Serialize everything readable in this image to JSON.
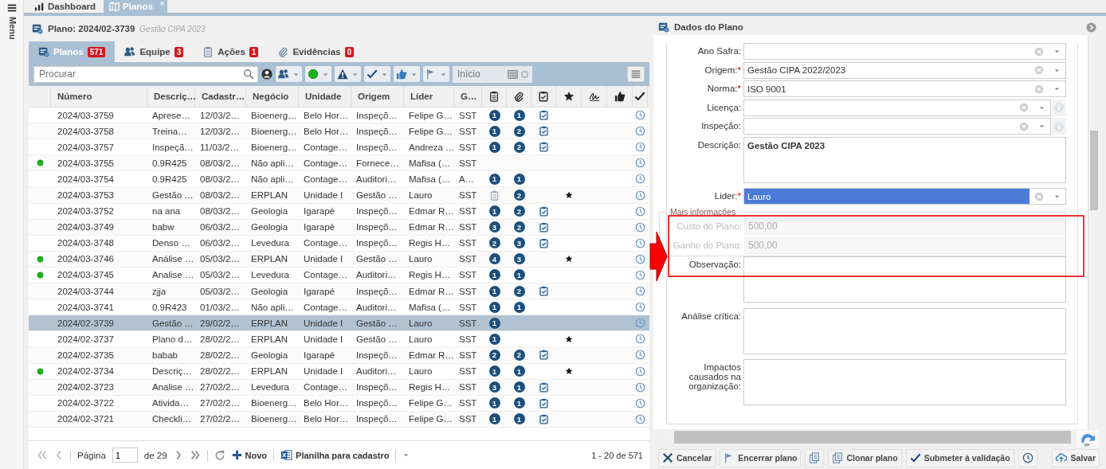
{
  "sidebar": {
    "label": "Menu"
  },
  "top_tabs": [
    {
      "label": "Dashboard",
      "kind": "chart",
      "selected": false
    },
    {
      "label": "Planos",
      "kind": "map",
      "selected": true,
      "close": "×"
    }
  ],
  "plan_header": {
    "title": "Plano: 2024/02-3739",
    "subtitle": "Gestão CIPA 2023"
  },
  "sub_tabs": [
    {
      "label": "Planos",
      "kind": "plans",
      "count": "571",
      "selected": true
    },
    {
      "label": "Equipe",
      "kind": "team",
      "count": "3",
      "selected": false
    },
    {
      "label": "Ações",
      "kind": "actions",
      "count": "1",
      "selected": false
    },
    {
      "label": "Evidências",
      "kind": "evidence",
      "count": "0",
      "selected": false
    }
  ],
  "toolbar": {
    "search_placeholder": "Procurar",
    "date_placeholder": "Início"
  },
  "table": {
    "columns": [
      "Número",
      "Descriç…",
      "Cadastr…",
      "Negócio",
      "Unidade",
      "Origem",
      "Líder",
      "G…"
    ],
    "rows": [
      {
        "number": "2024/03-3759",
        "description": "Aprese…",
        "created": "12/03/2…",
        "business": "Bioenerg…",
        "unit": "Belo Hor…",
        "origin": "Inspeçõ…",
        "leader": "Felipe G…",
        "group": "SST",
        "marked": false,
        "actions": "1",
        "evidences": "1",
        "checklist": true,
        "award": false,
        "selected": false
      },
      {
        "number": "2024/03-3758",
        "description": "Treina…",
        "created": "12/03/2…",
        "business": "Bioenerg…",
        "unit": "Belo Hor…",
        "origin": "Inspeçõ…",
        "leader": "Felipe G…",
        "group": "SST",
        "marked": false,
        "actions": "1",
        "evidences": "2",
        "checklist": true,
        "award": false,
        "selected": false
      },
      {
        "number": "2024/03-3757",
        "description": "Inspeçã…",
        "created": "11/03/2…",
        "business": "Bioenerg…",
        "unit": "Contage…",
        "origin": "Inspeçõ…",
        "leader": "Andreza …",
        "group": "SST",
        "marked": false,
        "actions": "1",
        "evidences": "2",
        "checklist": true,
        "award": false,
        "selected": false
      },
      {
        "number": "2024/03-3755",
        "description": "0.9R425",
        "created": "08/03/2…",
        "business": "Não apli…",
        "unit": "Contage…",
        "origin": "Fornece…",
        "leader": "Mafisa (…",
        "group": "SST",
        "marked": true,
        "checklist": false,
        "award": false,
        "selected": false
      },
      {
        "number": "2024/03-3754",
        "description": "0.9R425",
        "created": "08/03/2…",
        "business": "Não apli…",
        "unit": "Contage…",
        "origin": "Auditori…",
        "leader": "Mafisa (…",
        "group": "A…",
        "marked": false,
        "actions": "1",
        "evidences": "1",
        "checklist": false,
        "award": false,
        "selected": false
      },
      {
        "number": "2024/03-3753",
        "description": "Gestão …",
        "created": "08/03/2…",
        "business": "ERPLAN",
        "unit": "Unidade I",
        "origin": "Gestão …",
        "leader": "Lauro",
        "group": "SST",
        "marked": false,
        "actions_icon": true,
        "evidences": "2",
        "checklist": false,
        "award": true,
        "selected": false
      },
      {
        "number": "2024/03-3752",
        "description": "na ana",
        "created": "08/03/2…",
        "business": "Geologia",
        "unit": "Igarapé",
        "origin": "Inspeçõ…",
        "leader": "Edmar R…",
        "group": "SST",
        "marked": false,
        "actions": "1",
        "evidences": "2",
        "checklist": true,
        "award": false,
        "selected": false
      },
      {
        "number": "2024/03-3749",
        "description": "babw",
        "created": "06/03/2…",
        "business": "Geologia",
        "unit": "Igarapé",
        "origin": "Inspeçõ…",
        "leader": "Edmar R…",
        "group": "SST",
        "marked": false,
        "actions": "3",
        "evidences": "2",
        "checklist": true,
        "award": false,
        "selected": false
      },
      {
        "number": "2024/03-3748",
        "description": "Denso …",
        "created": "06/03/2…",
        "business": "Levedura",
        "unit": "Contage…",
        "origin": "Inspeçõ…",
        "leader": "Regis H…",
        "group": "SST",
        "marked": false,
        "actions": "2",
        "evidences": "3",
        "checklist": true,
        "award": false,
        "selected": false
      },
      {
        "number": "2024/03-3746",
        "description": "Análise …",
        "created": "05/03/2…",
        "business": "ERPLAN",
        "unit": "Unidade I",
        "origin": "Gestão …",
        "leader": "Lauro",
        "group": "SST",
        "marked": true,
        "actions": "4",
        "evidences": "3",
        "checklist": false,
        "award": true,
        "selected": false
      },
      {
        "number": "2024/03-3745",
        "description": "Analise …",
        "created": "05/03/2…",
        "business": "Levedura",
        "unit": "Contage…",
        "origin": "Auditori…",
        "leader": "Regis H…",
        "group": "SST",
        "marked": true,
        "actions": "1",
        "evidences": "1",
        "checklist": false,
        "award": false,
        "selected": false
      },
      {
        "number": "2024/03-3744",
        "description": "zjja",
        "created": "05/03/2…",
        "business": "Geologia",
        "unit": "Igarapé",
        "origin": "Inspeçõ…",
        "leader": "Edmar R…",
        "group": "SST",
        "marked": false,
        "actions": "1",
        "evidences": "2",
        "checklist": true,
        "award": false,
        "selected": false
      },
      {
        "number": "2024/03-3741",
        "description": "0.9R423",
        "created": "01/03/2…",
        "business": "Não apli…",
        "unit": "Contage…",
        "origin": "Auditori…",
        "leader": "Mafisa (…",
        "group": "SST",
        "marked": false,
        "actions": "1",
        "evidences": "1",
        "checklist": false,
        "award": false,
        "selected": false
      },
      {
        "number": "2024/02-3739",
        "description": "Gestão …",
        "created": "29/02/2…",
        "business": "ERPLAN",
        "unit": "Unidade I",
        "origin": "Gestão …",
        "leader": "Lauro",
        "group": "SST",
        "marked": false,
        "actions": "1",
        "checklist": false,
        "award": false,
        "selected": true
      },
      {
        "number": "2024/02-3737",
        "description": "Plano d…",
        "created": "28/02/2…",
        "business": "ERPLAN",
        "unit": "Unidade I",
        "origin": "Gestão …",
        "leader": "Lauro",
        "group": "SST",
        "marked": false,
        "actions": "1",
        "checklist": false,
        "award": true,
        "selected": false
      },
      {
        "number": "2024/02-3735",
        "description": "babab",
        "created": "28/02/2…",
        "business": "Geologia",
        "unit": "Igarapé",
        "origin": "Inspeçõ…",
        "leader": "Edmar R…",
        "group": "SST",
        "marked": false,
        "actions": "2",
        "evidences": "2",
        "checklist": true,
        "award": false,
        "selected": false
      },
      {
        "number": "2024/02-3734",
        "description": "Descriç…",
        "created": "28/02/2…",
        "business": "ERPLAN",
        "unit": "Unidade I",
        "origin": "Auditori…",
        "leader": "Lauro",
        "group": "SST",
        "marked": true,
        "actions": "1",
        "evidences": "1",
        "checklist": false,
        "award": true,
        "selected": false
      },
      {
        "number": "2024/02-3723",
        "description": "Analise …",
        "created": "27/02/2…",
        "business": "Levedura",
        "unit": "Contage…",
        "origin": "Inspeçõ…",
        "leader": "Regis H…",
        "group": "SST",
        "marked": false,
        "actions": "3",
        "evidences": "1",
        "checklist": true,
        "award": false,
        "selected": false
      },
      {
        "number": "2024/02-3722",
        "description": "Ativida…",
        "created": "27/02/2…",
        "business": "Bioenerg…",
        "unit": "Belo Hor…",
        "origin": "Inspeçõ…",
        "leader": "Felipe G…",
        "group": "SST",
        "marked": false,
        "actions": "1",
        "evidences": "1",
        "checklist": true,
        "award": false,
        "selected": false
      },
      {
        "number": "2024/02-3721",
        "description": "Checkli…",
        "created": "27/02/2…",
        "business": "Bioenerg…",
        "unit": "Belo Hor…",
        "origin": "Inspeçõ…",
        "leader": "Felipe G…",
        "group": "SST",
        "marked": false,
        "actions": "1",
        "evidences": "1",
        "checklist": true,
        "award": false,
        "selected": false
      }
    ]
  },
  "pager": {
    "page_label": "Página",
    "page": "1",
    "page_count": "de 29",
    "new_label": "Novo",
    "spreadsheet_label": "Planilha para cadastro",
    "range": "1 - 20 de 571"
  },
  "form": {
    "title": "Dados do Plano",
    "fields": [
      {
        "label": "Ano Safra:",
        "kind": "select",
        "highlighted": false
      },
      {
        "label": "Origem:",
        "required_mark": "*",
        "kind": "select",
        "value": "Gestão CIPA 2022/2023",
        "highlighted": false
      },
      {
        "label": "Norma:",
        "required_mark": "*",
        "kind": "select",
        "value": "ISO 9001",
        "highlighted": false
      },
      {
        "label": "Licença:",
        "kind": "select_info",
        "highlighted": false
      },
      {
        "label": "Inspeção:",
        "kind": "select_info",
        "highlighted": false
      },
      {
        "label": "Descrição:",
        "kind": "textarea",
        "value": "Gestão CIPA 2023"
      },
      {
        "label": "Lider:",
        "required_mark": "*",
        "kind": "select",
        "value": "Lauro",
        "highlighted": true
      }
    ],
    "group": {
      "legend": "Mais informações",
      "fields": [
        {
          "label": "Custo do Plano:",
          "kind": "readonly",
          "value": "500,00"
        },
        {
          "label": "Ganho do Plano:",
          "kind": "readonly",
          "value": "500,00"
        }
      ]
    },
    "more_fields": [
      {
        "label": "Observação:",
        "kind": "textarea"
      },
      {
        "label": "Análise crítica:",
        "kind": "textarea"
      },
      {
        "label": "Impactos causados na organização:",
        "kind": "textarea"
      }
    ]
  },
  "actions": [
    {
      "kind": "cancel",
      "label": "Cancelar"
    },
    {
      "kind": "close",
      "label": "Encerrar plano"
    },
    {
      "kind": "copy"
    },
    {
      "kind": "clone",
      "label": "Clonar plano"
    },
    {
      "kind": "submit",
      "label": "Submeter à validação"
    },
    {
      "kind": "history"
    },
    {
      "kind": "save",
      "label": "Salvar"
    }
  ]
}
